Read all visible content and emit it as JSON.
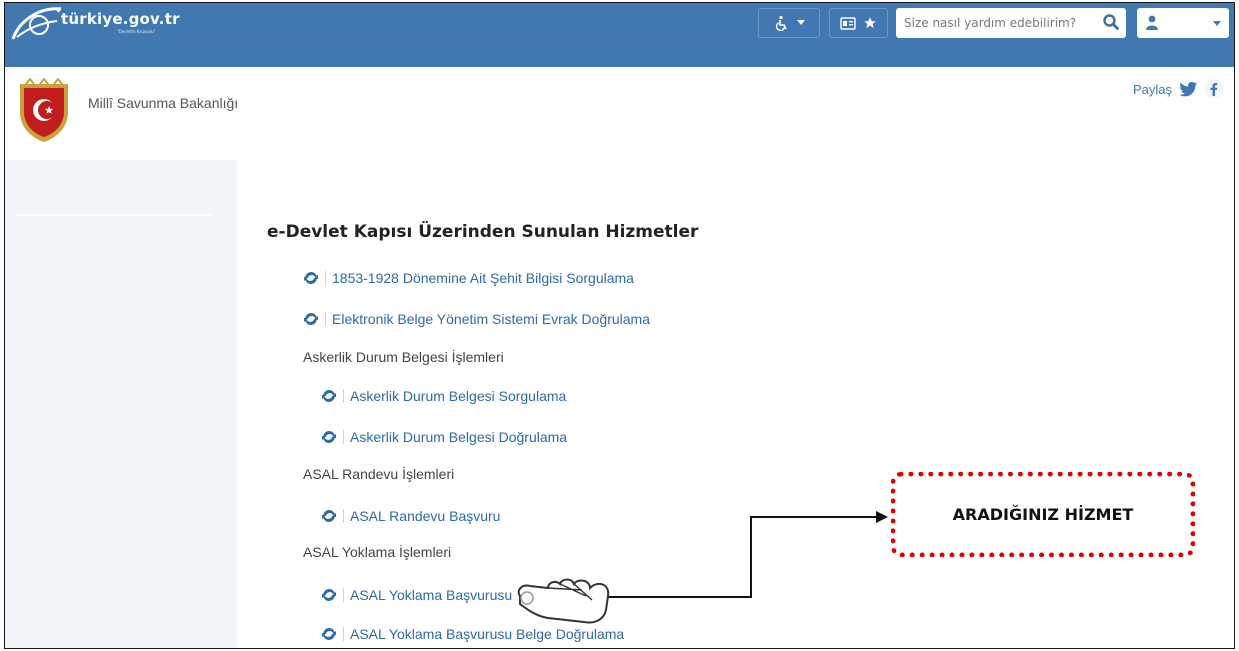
{
  "topbar": {
    "logo_text": "türkiye.gov.tr",
    "logo_sub": "\"Devletin Kısayolu\"",
    "search_placeholder": "Size nasıl yardım edebilirim?",
    "brand_color": "#4178b1"
  },
  "header": {
    "ministry": "Millî Savunma Bakanlığı",
    "share_label": "Paylaş"
  },
  "content": {
    "title": "e-Devlet Kapısı Üzerinden Sunulan Hizmetler",
    "services": [
      "1853-1928 Dönemine Ait Şehit Bilgisi Sorgulama",
      "Elektronik Belge Yönetim Sistemi Evrak Doğrulama"
    ],
    "groups": [
      {
        "name": "Askerlik Durum Belgesi İşlemleri",
        "items": [
          "Askerlik Durum Belgesi Sorgulama",
          "Askerlik Durum Belgesi Doğrulama"
        ]
      },
      {
        "name": "ASAL Randevu İşlemleri",
        "items": [
          "ASAL Randevu Başvuru"
        ]
      },
      {
        "name": "ASAL Yoklama İşlemleri",
        "items": [
          "ASAL Yoklama Başvurusu",
          "ASAL Yoklama Başvurusu Belge Doğrulama"
        ]
      }
    ]
  },
  "annotation": {
    "callout_text": "ARADIĞINIZ HİZMET",
    "callout_color": "#e00000"
  }
}
